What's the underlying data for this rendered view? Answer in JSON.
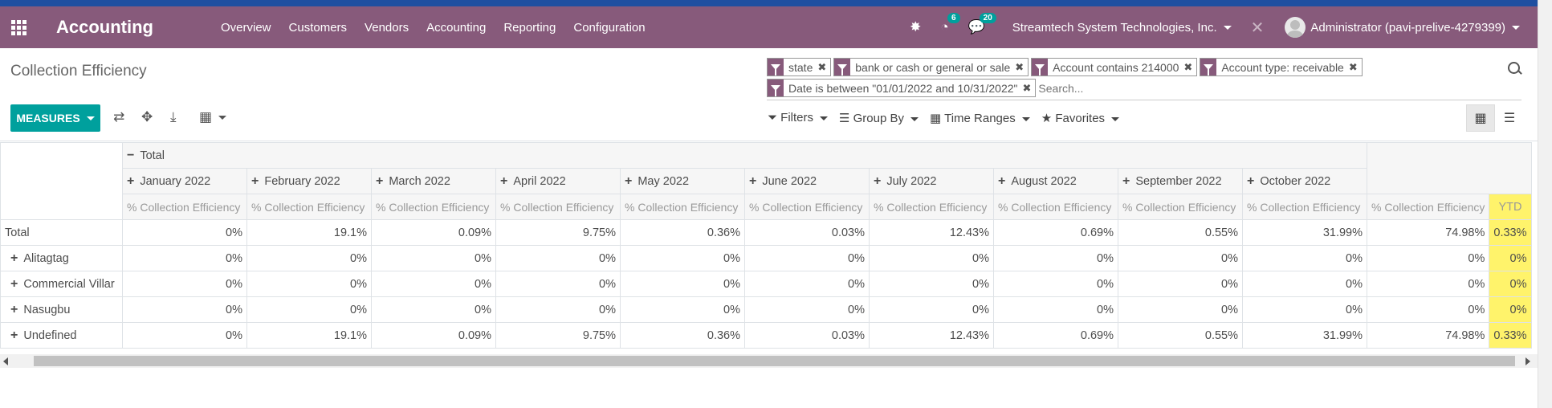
{
  "navbar": {
    "brand": "Accounting",
    "menu": [
      "Overview",
      "Customers",
      "Vendors",
      "Accounting",
      "Reporting",
      "Configuration"
    ],
    "activity_badge": "6",
    "messages_badge": "20",
    "company": "Streamtech System Technologies, Inc.",
    "user": "Administrator (pavi-prelive-4279399)",
    "bg_color": "#875a7b"
  },
  "page": {
    "title": "Collection Efficiency"
  },
  "search": {
    "facets": [
      "state",
      "bank or cash or general or sale",
      "Account contains 214000",
      "Account type: receivable",
      "Date is between \"01/01/2022 and 10/31/2022\""
    ],
    "placeholder": "Search...",
    "options": [
      "Filters",
      "Group By",
      "Time Ranges",
      "Favorites"
    ]
  },
  "toolbar": {
    "measures_label": "MEASURES",
    "accent_color": "#00a09d"
  },
  "pivot": {
    "total_header": "Total",
    "columns": [
      "January 2022",
      "February 2022",
      "March 2022",
      "April 2022",
      "May 2022",
      "June 2022",
      "July 2022",
      "August 2022",
      "September 2022",
      "October 2022"
    ],
    "measure": "% Collection Efficiency",
    "ytd_header": "YTD",
    "rows": [
      {
        "label": "Total",
        "values": [
          "0%",
          "19.1%",
          "0.09%",
          "9.75%",
          "0.36%",
          "0.03%",
          "12.43%",
          "0.69%",
          "0.55%",
          "31.99%"
        ],
        "total": "74.98%",
        "ytd": "0.33%"
      },
      {
        "label": "Alitagtag",
        "values": [
          "0%",
          "0%",
          "0%",
          "0%",
          "0%",
          "0%",
          "0%",
          "0%",
          "0%",
          "0%"
        ],
        "total": "0%",
        "ytd": "0%"
      },
      {
        "label": "Commercial Villar",
        "values": [
          "0%",
          "0%",
          "0%",
          "0%",
          "0%",
          "0%",
          "0%",
          "0%",
          "0%",
          "0%"
        ],
        "total": "0%",
        "ytd": "0%"
      },
      {
        "label": "Nasugbu",
        "values": [
          "0%",
          "0%",
          "0%",
          "0%",
          "0%",
          "0%",
          "0%",
          "0%",
          "0%",
          "0%"
        ],
        "total": "0%",
        "ytd": "0%"
      },
      {
        "label": "Undefined",
        "values": [
          "0%",
          "19.1%",
          "0.09%",
          "9.75%",
          "0.36%",
          "0.03%",
          "12.43%",
          "0.69%",
          "0.55%",
          "31.99%"
        ],
        "total": "74.98%",
        "ytd": "0.33%"
      }
    ],
    "highlight_color": "#fff36b"
  }
}
